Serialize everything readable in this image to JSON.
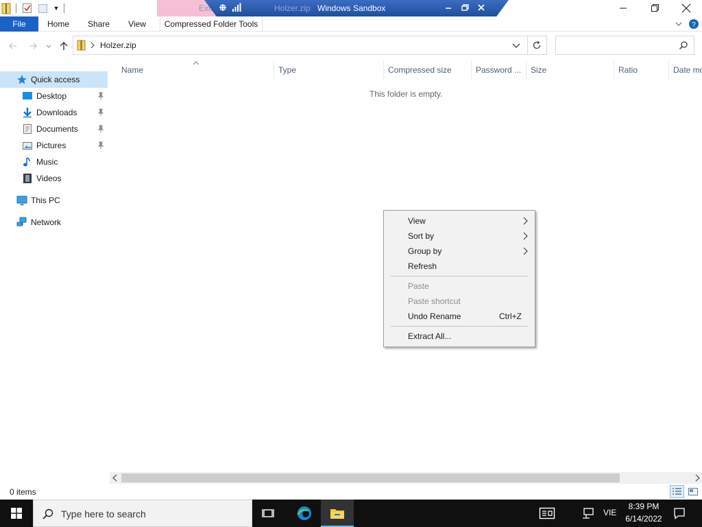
{
  "titlebar": {
    "faded_explorer_text": "Extr",
    "faded_holzer_text": "Holzer.zip",
    "sandbox_title": "Windows Sandbox"
  },
  "ribbon": {
    "tabs": [
      "File",
      "Home",
      "Share",
      "View",
      "Compressed Folder Tools"
    ],
    "accent": "#1a62c4"
  },
  "address": {
    "path": "Holzer.zip",
    "search_placeholder": ""
  },
  "navpane": {
    "quick_access": "Quick access",
    "items": [
      "Desktop",
      "Downloads",
      "Documents",
      "Pictures",
      "Music",
      "Videos"
    ],
    "this_pc": "This PC",
    "network": "Network"
  },
  "columns": [
    "Name",
    "Type",
    "Compressed size",
    "Password ...",
    "Size",
    "Ratio",
    "Date mo"
  ],
  "content": {
    "empty_message": "This folder is empty."
  },
  "context_menu": {
    "view": "View",
    "sort_by": "Sort by",
    "group_by": "Group by",
    "refresh": "Refresh",
    "paste": "Paste",
    "paste_shortcut": "Paste shortcut",
    "undo_rename": "Undo Rename",
    "undo_shortcut": "Ctrl+Z",
    "extract_all": "Extract All..."
  },
  "status": {
    "items": "0 items"
  },
  "taskbar": {
    "search_placeholder": "Type here to search",
    "language": "VIE",
    "time": "8:39 PM",
    "date": "6/14/2022"
  },
  "icons": {
    "quick_access": "star-icon",
    "desktop": "desktop-icon",
    "downloads": "download-arrow-icon",
    "documents": "document-icon",
    "pictures": "picture-icon",
    "music": "music-note-icon",
    "videos": "film-icon",
    "this_pc": "monitor-icon",
    "network": "network-icon"
  }
}
